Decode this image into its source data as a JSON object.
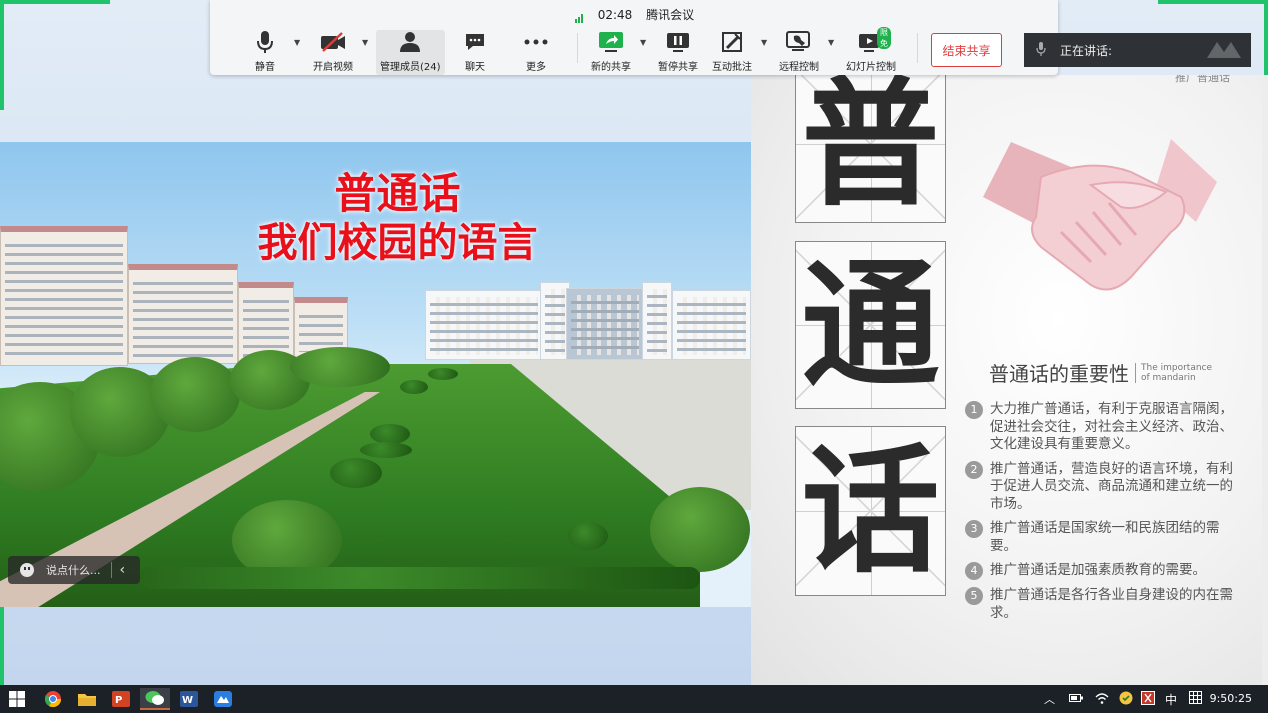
{
  "meeting": {
    "timer": "02:48",
    "app_name": "腾讯会议",
    "toolbar": [
      {
        "id": "mute",
        "label": "静音",
        "icon": "microphone-icon"
      },
      {
        "id": "video",
        "label": "开启视频",
        "icon": "camera-off-icon"
      },
      {
        "id": "members",
        "label": "管理成员(24)",
        "icon": "user-icon"
      },
      {
        "id": "chat",
        "label": "聊天",
        "icon": "chat-icon"
      },
      {
        "id": "more",
        "label": "更多",
        "icon": "more-icon"
      },
      {
        "id": "new_share",
        "label": "新的共享",
        "icon": "screen-share-icon"
      },
      {
        "id": "pause_share",
        "label": "暂停共享",
        "icon": "pause-icon"
      },
      {
        "id": "annotate",
        "label": "互动批注",
        "icon": "annotate-icon"
      },
      {
        "id": "remote",
        "label": "远程控制",
        "icon": "remote-control-icon"
      },
      {
        "id": "slides",
        "label": "幻灯片控制",
        "icon": "slide-control-icon",
        "badge": "限免"
      }
    ],
    "end_share_label": "结束共享",
    "speaking_label": "正在讲话:",
    "accent_color": "#1fc36a",
    "end_color": "#e03c3c"
  },
  "slide_left": {
    "title_line1": "普通话",
    "title_line2": "我们校园的语言",
    "title_color": "#e8101a"
  },
  "chat_input": {
    "placeholder": "说点什么..."
  },
  "slide_right": {
    "top_label": "推广普通话",
    "big_chars": [
      "普",
      "通",
      "话"
    ],
    "importance_title": "普通话的重要性",
    "importance_subtitle": "The importance of mandarin",
    "points": [
      {
        "num": "1",
        "text": "大力推广普通话，有利于克服语言隔阂，促进社会交往，对社会主义经济、政治、文化建设具有重要意义。"
      },
      {
        "num": "2",
        "text": "推广普通话，营造良好的语言环境，有利于促进人员交流、商品流通和建立统一的市场。"
      },
      {
        "num": "3",
        "text": "推广普通话是国家统一和民族团结的需要。"
      },
      {
        "num": "4",
        "text": "推广普通话是加强素质教育的需要。"
      },
      {
        "num": "5",
        "text": "推广普通话是各行各业自身建设的内在需求。"
      }
    ]
  },
  "taskbar": {
    "apps": [
      "windows-start-icon",
      "chrome-icon",
      "file-explorer-icon",
      "powerpoint-icon",
      "wechat-icon",
      "word-icon",
      "tencent-meeting-icon"
    ],
    "tray_ime": "中",
    "clock": "9:50:25"
  }
}
